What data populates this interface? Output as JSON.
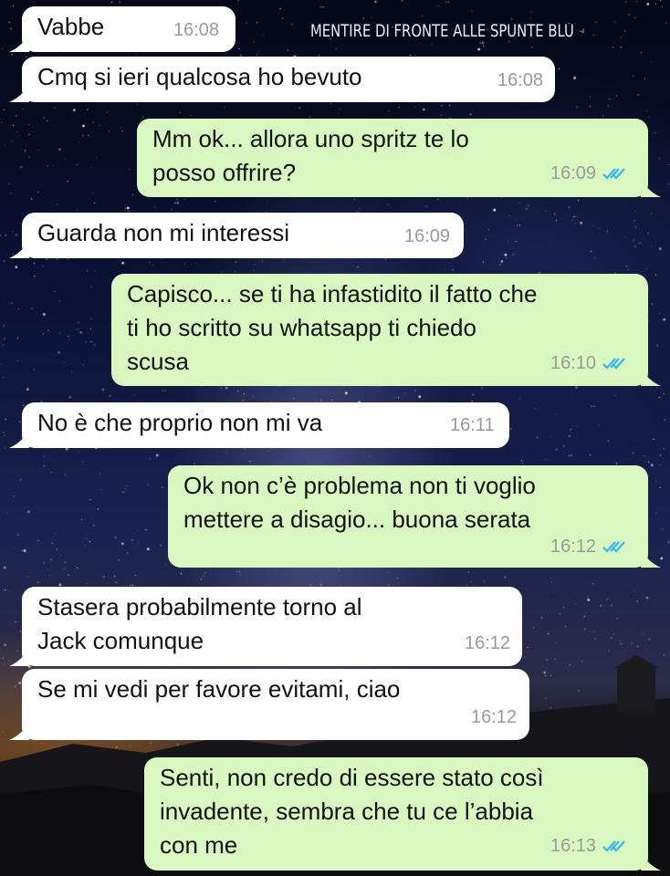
{
  "watermark": {
    "text": "MENTIRE DI FRONTE ALLE SPUNTE BLU",
    "icon": "ship-icon"
  },
  "colors": {
    "incoming": "#ffffff",
    "outgoing": "#d9f8c0",
    "read_ticks": "#34b7f1",
    "time": "#9a9a9a"
  },
  "messages": [
    {
      "direction": "in",
      "text": "Vabbe",
      "time": "16:08"
    },
    {
      "direction": "in",
      "text": "Cmq si ieri qualcosa ho bevuto",
      "time": "16:08"
    },
    {
      "direction": "out",
      "text": "Mm ok... allora uno spritz te lo\nposso offrire?",
      "time": "16:09",
      "status": "read"
    },
    {
      "direction": "in",
      "text": "Guarda non mi interessi",
      "time": "16:09"
    },
    {
      "direction": "out",
      "text": "Capisco... se ti ha infastidito il fatto che\nti ho scritto su whatsapp ti chiedo\nscusa",
      "time": "16:10",
      "status": "read"
    },
    {
      "direction": "in",
      "text": "No è che proprio non mi va",
      "time": "16:11"
    },
    {
      "direction": "out",
      "text": "Ok non c’è problema non ti voglio\nmettere a disagio... buona serata",
      "time": "16:12",
      "status": "read"
    },
    {
      "direction": "in",
      "text": "Stasera probabilmente torno al\nJack comunque",
      "time": "16:12"
    },
    {
      "direction": "in",
      "text": "Se mi vedi per favore evitami, ciao",
      "time": "16:12"
    },
    {
      "direction": "out",
      "text": "Senti, non credo di essere stato così\ninvadente, sembra che tu ce l’abbia\ncon me",
      "time": "16:13",
      "status": "read"
    }
  ]
}
